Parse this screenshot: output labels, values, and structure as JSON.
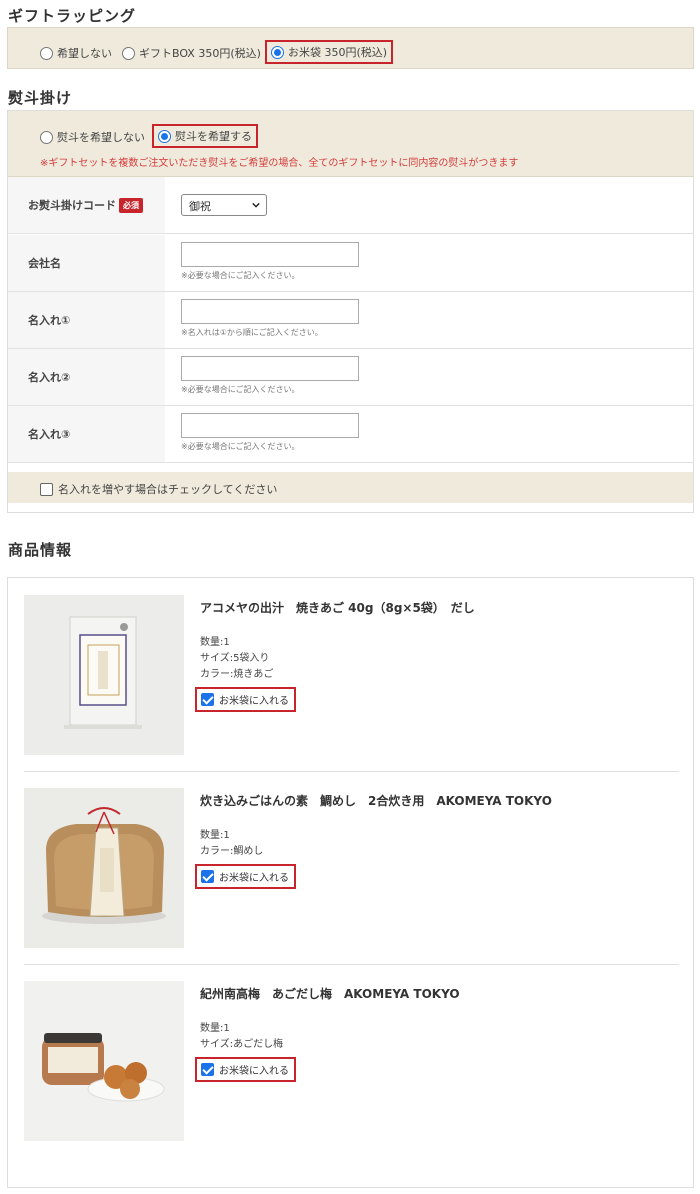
{
  "wrapping": {
    "title": "ギフトラッピング",
    "options": [
      "希望しない",
      "ギフトBOX 350円(税込)",
      "お米袋 350円(税込)"
    ]
  },
  "noshi": {
    "title": "熨斗掛け",
    "options": [
      "熨斗を希望しない",
      "熨斗を希望する"
    ],
    "note": "※ギフトセットを複数ご注文いただき熨斗をご希望の場合、全てのギフトセットに同内容の熨斗がつきます",
    "rows": [
      {
        "label": "お熨斗掛けコード",
        "badge": "必須",
        "value": "御祝"
      },
      {
        "label": "会社名",
        "hint": "※必要な場合にご記入ください。"
      },
      {
        "label": "名入れ①",
        "hint": "※名入れは①から順にご記入ください。"
      },
      {
        "label": "名入れ②",
        "hint": "※必要な場合にご記入ください。"
      },
      {
        "label": "名入れ③",
        "hint": "※必要な場合にご記入ください。"
      }
    ],
    "add_names_label": "名入れを増やす場合はチェックしてください"
  },
  "products": {
    "title": "商品情報",
    "bag_label": "お米袋に入れる",
    "items": [
      {
        "name": "アコメヤの出汁　焼きあご 40g（8g×5袋）　だし",
        "attrs": [
          "数量:1",
          "サイズ:5袋入り",
          "カラー:焼きあご"
        ]
      },
      {
        "name": "炊き込みごはんの素　鯛めし　2合炊き用　AKOMEYA TOKYO",
        "attrs": [
          "数量:1",
          "カラー:鯛めし"
        ]
      },
      {
        "name": "紀州南高梅　あごだし梅　AKOMEYA TOKYO",
        "attrs": [
          "数量:1",
          "サイズ:あごだし梅"
        ]
      }
    ]
  },
  "colors": {
    "accent_red": "#c8242b",
    "beige": "#efeadc",
    "check_blue": "#1a73e8",
    "note_red": "#d43c3c"
  }
}
